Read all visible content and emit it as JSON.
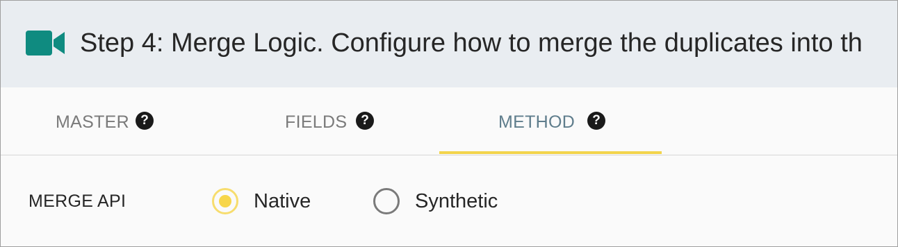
{
  "header": {
    "icon": "video-camera-icon",
    "icon_color": "#0f8b80",
    "title": "Step 4: Merge Logic. Configure how to merge the duplicates into th"
  },
  "tabs": [
    {
      "label": "MASTER",
      "help": "?",
      "active": false
    },
    {
      "label": "FIELDS",
      "help": "?",
      "active": false
    },
    {
      "label": "METHOD",
      "help": "?",
      "active": true
    }
  ],
  "colors": {
    "active_tab_text": "#5f7d8c",
    "tab_underline": "#f2d44c",
    "radio_selected": "#f7d64a"
  },
  "merge_api": {
    "label": "MERGE API",
    "options": [
      {
        "label": "Native",
        "selected": true
      },
      {
        "label": "Synthetic",
        "selected": false
      }
    ]
  }
}
